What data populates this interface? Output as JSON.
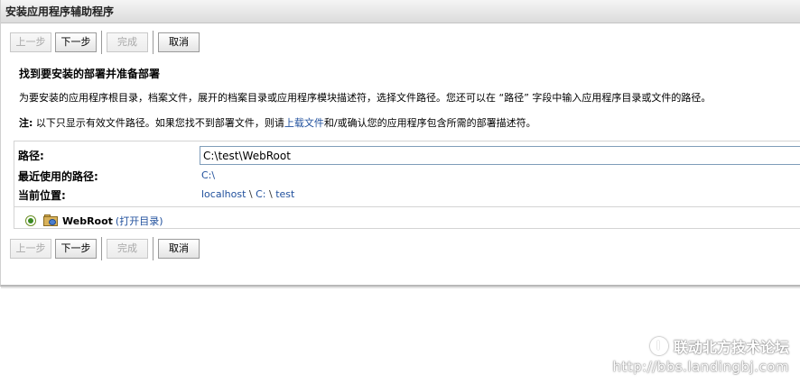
{
  "window": {
    "title": "安装应用程序辅助程序"
  },
  "toolbar": {
    "prev_label": "上一步",
    "next_label": "下一步",
    "finish_label": "完成",
    "cancel_label": "取消"
  },
  "section": {
    "heading": "找到要安装的部署并准备部署",
    "description": "为要安装的应用程序根目录，档案文件，展开的档案目录或应用程序模块描述符，选择文件路径。您还可以在 “路径” 字段中输入应用程序目录或文件的路径。",
    "note_label": "注:",
    "note_text_1": " 以下只显示有效文件路径。如果您找不到部署文件，则请",
    "note_link": "上载文件",
    "note_text_2": "和/或确认您的应用程序包含所需的部署描述符。"
  },
  "form": {
    "path_label": "路径:",
    "path_value": "C:\\test\\WebRoot",
    "recent_label": "最近使用的路径:",
    "recent_value": "C:\\",
    "current_label": "当前位置:",
    "current_host": "localhost",
    "current_sep1": " \\ ",
    "current_drive": "C:",
    "current_sep2": " \\ ",
    "current_dir": "test"
  },
  "directory": {
    "name": "WebRoot",
    "open_label": "(打开目录)",
    "icon": "web-folder-icon",
    "selected": true
  },
  "watermark": {
    "line1": "联动北方技术论坛",
    "line2": "http://bbs.landingbj.com"
  }
}
